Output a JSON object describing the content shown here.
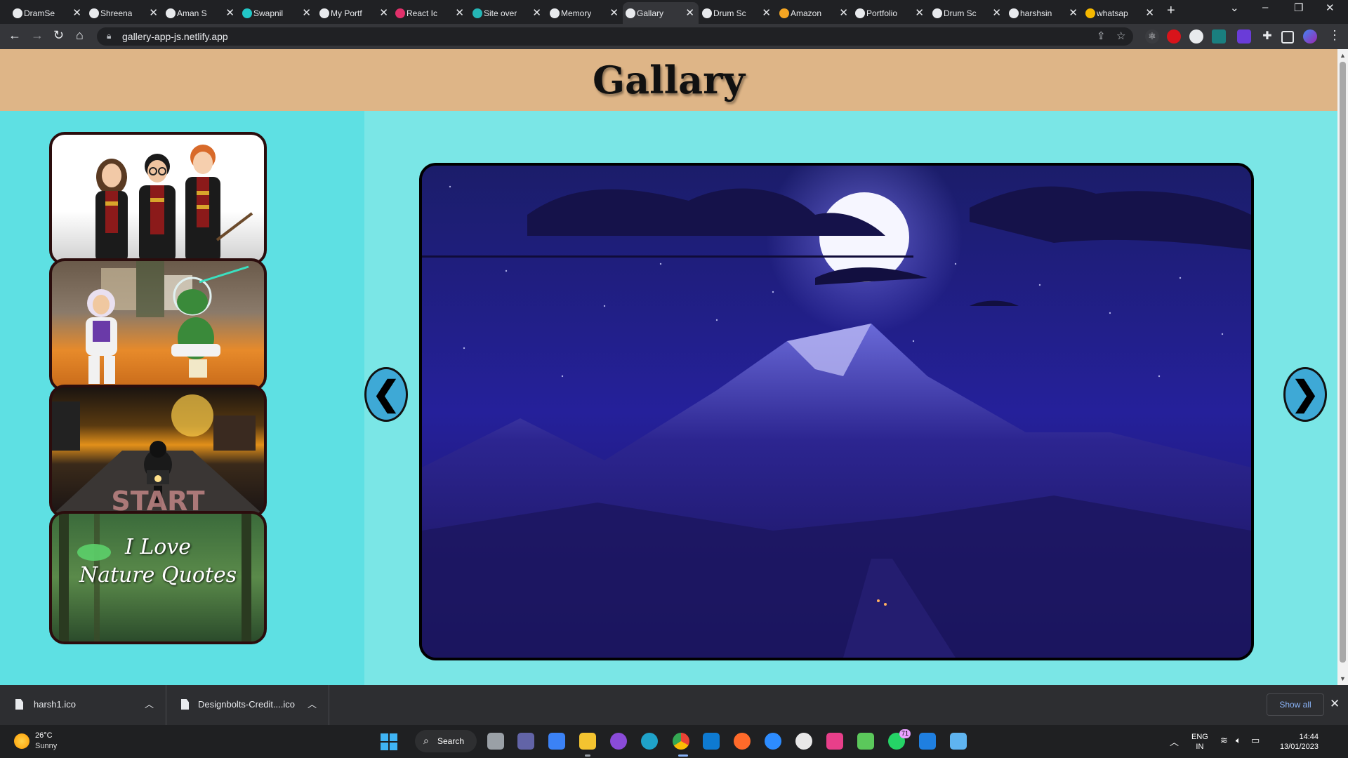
{
  "browser": {
    "tabs": [
      {
        "label": "DramSe",
        "favicon_color": "#e8eaed"
      },
      {
        "label": "Shreena",
        "favicon_color": "#e8eaed"
      },
      {
        "label": "Aman S",
        "favicon_color": "#e8eaed"
      },
      {
        "label": "Swapnil",
        "favicon_color": "#22c7c7"
      },
      {
        "label": "My Portf",
        "favicon_color": "#e8eaed"
      },
      {
        "label": "React Ic",
        "favicon_color": "#e0306a"
      },
      {
        "label": "Site over",
        "favicon_color": "#25b6b6"
      },
      {
        "label": "Memory",
        "favicon_color": "#e8eaed"
      },
      {
        "label": "Gallary",
        "favicon_color": "#e8eaed",
        "active": true
      },
      {
        "label": "Drum Sc",
        "favicon_color": "#e8eaed"
      },
      {
        "label": "Amazon",
        "favicon_color": "#f5a623"
      },
      {
        "label": "Portfolio",
        "favicon_color": "#e8eaed"
      },
      {
        "label": "Drum Sc",
        "favicon_color": "#e8eaed"
      },
      {
        "label": "harshsin",
        "favicon_color": "#e8eaed"
      },
      {
        "label": "whatsap",
        "favicon_color": "#f5b800"
      }
    ],
    "url": "gallery-app-js.netlify.app"
  },
  "page": {
    "title": "Gallary",
    "thumbnails": [
      {
        "name": "harry-potter-trio",
        "caption": ""
      },
      {
        "name": "toy-story-scene",
        "caption": ""
      },
      {
        "name": "motorbike-start",
        "caption": ""
      },
      {
        "name": "nature-quotes",
        "caption": "I Love\nNature Quotes"
      }
    ],
    "prev_label": "❮",
    "next_label": "❯"
  },
  "downloads": {
    "items": [
      {
        "name": "harsh1.ico"
      },
      {
        "name": "Designbolts-Credit....ico"
      }
    ],
    "show_all": "Show all"
  },
  "taskbar": {
    "weather_temp": "26°C",
    "weather_cond": "Sunny",
    "search_label": "Search",
    "lang_top": "ENG",
    "lang_bottom": "IN",
    "time": "14:44",
    "date": "13/01/2023",
    "whatsapp_badge": "71"
  },
  "colors": {
    "header_bg": "#deb587",
    "sidebar_bg": "#5ee0e3",
    "main_bg": "#7ae6e6",
    "arrow_bg": "#3ea9d6"
  }
}
